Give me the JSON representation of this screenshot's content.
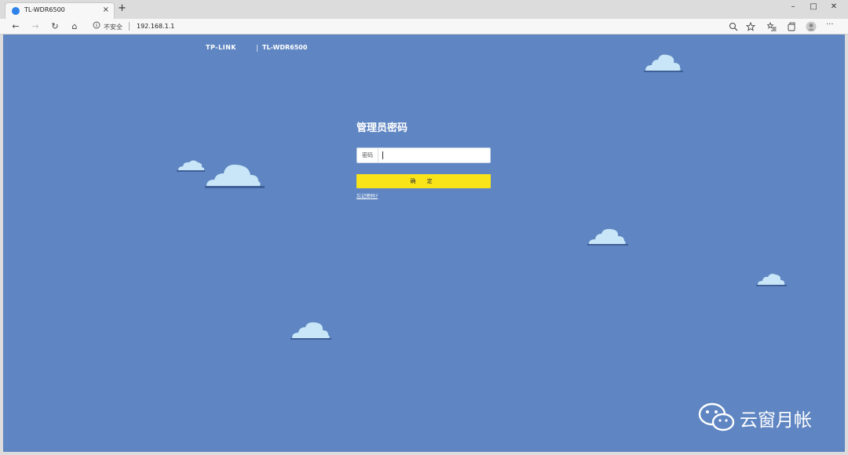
{
  "browser": {
    "tab_title": "TL-WDR6500",
    "tab_close": "×",
    "new_tab": "+",
    "window_controls": {
      "minimize": "–",
      "maximize": "□",
      "close": "✕"
    },
    "nav": {
      "back": "←",
      "forward": "→",
      "reload": "↻",
      "home": "⌂"
    },
    "address": {
      "security_text": "不安全",
      "url": "192.168.1.1"
    },
    "icons": [
      "back-icon",
      "forward-icon",
      "reload-icon",
      "home-icon",
      "info-icon",
      "zoom-icon",
      "star-icon",
      "favorites-icon",
      "collections-icon",
      "profile-icon",
      "more-icon"
    ]
  },
  "page": {
    "brand": "TP-LINK",
    "model": "TL-WDR6500",
    "login_title": "管理员密码",
    "password_label": "密码",
    "password_value": "",
    "confirm_button": "确 定",
    "forgot_link": "忘记密码?",
    "background_color": "#5f86c2",
    "button_color": "#f9e41a"
  },
  "watermark": {
    "text": "云窗月帐",
    "icon": "wechat-icon"
  }
}
